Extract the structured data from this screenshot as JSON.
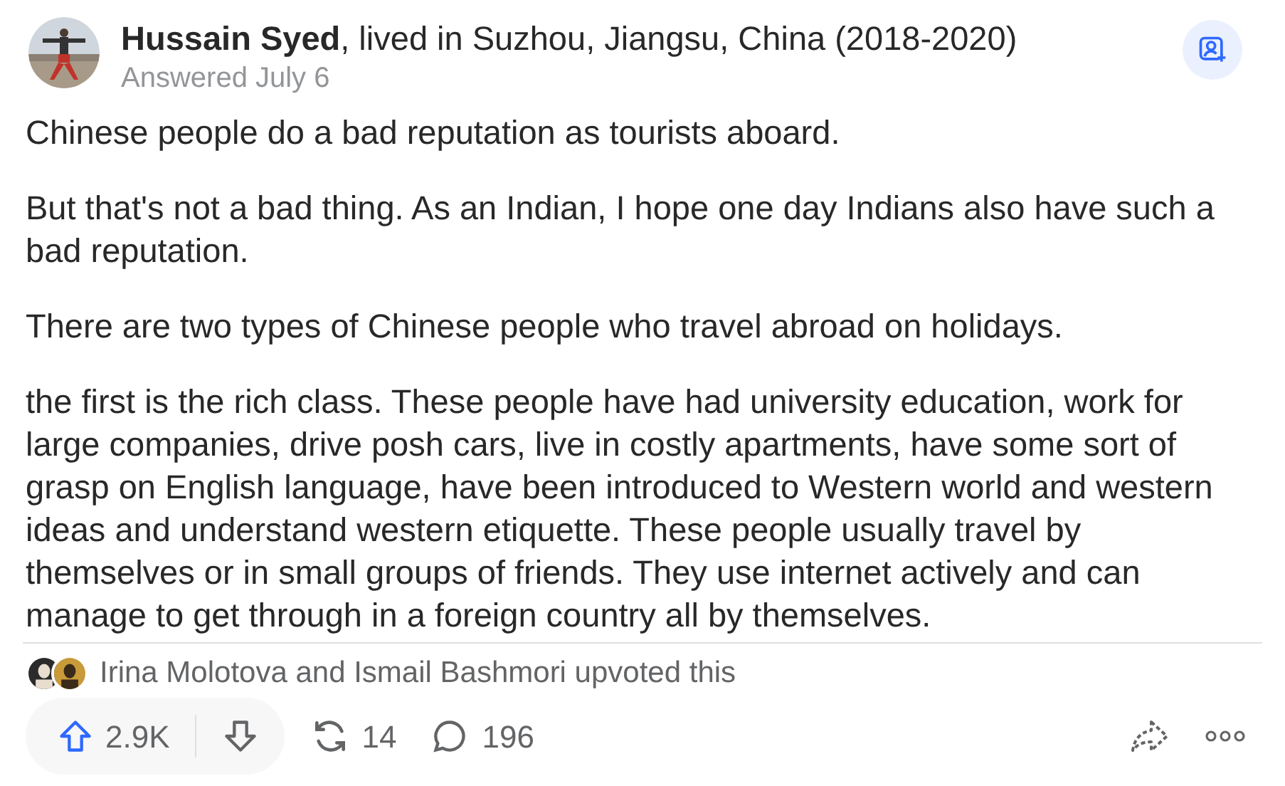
{
  "author": {
    "name": "Hussain Syed",
    "credential": ", lived in Suzhou, Jiangsu, China (2018-2020)",
    "date": "Answered July 6"
  },
  "answer": {
    "paragraphs": [
      "Chinese people do a bad reputation as tourists aboard.",
      "But that's not a bad thing. As an Indian, I hope one day Indians also have such a bad reputation.",
      "There are two types of Chinese people who travel abroad on holidays.",
      "the first is the rich class. These people have had university education, work for large companies, drive posh cars, live in costly apartments, have some sort of grasp on English language, have been introduced to Western world and western ideas and understand western etiquette. These people usually travel by themselves or in small groups of friends. They use internet actively and can manage to get through in a foreign country all by themselves."
    ]
  },
  "upvoters": {
    "text": "Irina Molotova and Ismail Bashmori upvoted this"
  },
  "actions": {
    "upvotes": "2.9K",
    "upvoted": false,
    "shares": "14",
    "comments": "196"
  }
}
